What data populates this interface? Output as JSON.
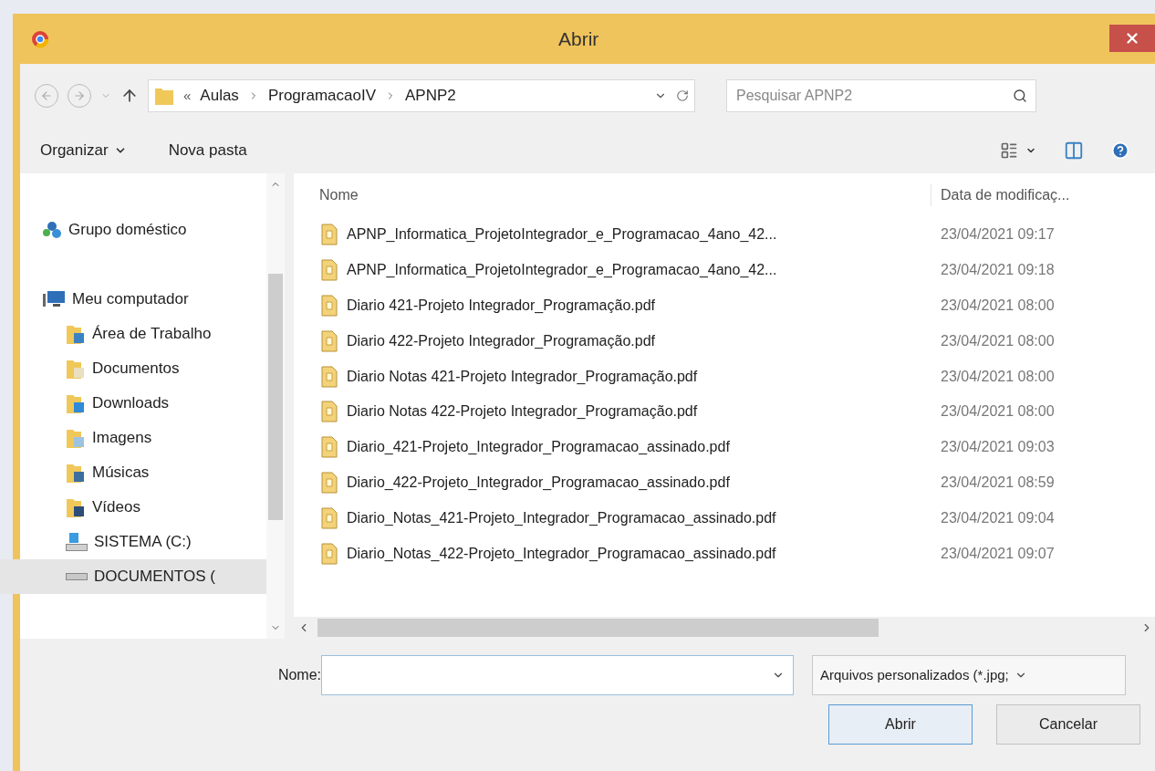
{
  "window": {
    "title": "Abrir"
  },
  "address": {
    "prefix": "«",
    "path": [
      "Aulas",
      "ProgramacaoIV",
      "APNP2"
    ]
  },
  "search": {
    "placeholder": "Pesquisar APNP2"
  },
  "toolbar": {
    "organize": "Organizar",
    "new_folder": "Nova pasta"
  },
  "sidebar": {
    "items": [
      {
        "label": "Grupo doméstico",
        "kind": "group",
        "selected": false
      },
      {
        "label": "Meu computador",
        "kind": "computer",
        "selected": false,
        "children": [
          {
            "label": "Área de Trabalho",
            "kind": "desktop",
            "selected": false
          },
          {
            "label": "Documentos",
            "kind": "documents",
            "selected": false
          },
          {
            "label": "Downloads",
            "kind": "downloads",
            "selected": false
          },
          {
            "label": "Imagens",
            "kind": "images",
            "selected": false
          },
          {
            "label": "Músicas",
            "kind": "music",
            "selected": false
          },
          {
            "label": "Vídeos",
            "kind": "videos",
            "selected": false
          },
          {
            "label": "SISTEMA (C:)",
            "kind": "system-drive",
            "selected": false
          },
          {
            "label": "DOCUMENTOS (",
            "kind": "drive",
            "selected": true
          }
        ]
      }
    ]
  },
  "table": {
    "columns": [
      "Nome",
      "Data de modificaç..."
    ],
    "rows": [
      {
        "name": "APNP_Informatica_ProjetoIntegrador_e_Programacao_4ano_42...",
        "date": "23/04/2021 09:17"
      },
      {
        "name": "APNP_Informatica_ProjetoIntegrador_e_Programacao_4ano_42...",
        "date": "23/04/2021 09:18"
      },
      {
        "name": "Diario 421-Projeto Integrador_Programação.pdf",
        "date": "23/04/2021 08:00"
      },
      {
        "name": "Diario 422-Projeto Integrador_Programação.pdf",
        "date": "23/04/2021 08:00"
      },
      {
        "name": "Diario Notas 421-Projeto Integrador_Programação.pdf",
        "date": "23/04/2021 08:00"
      },
      {
        "name": "Diario Notas 422-Projeto Integrador_Programação.pdf",
        "date": "23/04/2021 08:00"
      },
      {
        "name": "Diario_421-Projeto_Integrador_Programacao_assinado.pdf",
        "date": "23/04/2021 09:03"
      },
      {
        "name": "Diario_422-Projeto_Integrador_Programacao_assinado.pdf",
        "date": "23/04/2021 08:59"
      },
      {
        "name": "Diario_Notas_421-Projeto_Integrador_Programacao_assinado.pdf",
        "date": "23/04/2021 09:04"
      },
      {
        "name": "Diario_Notas_422-Projeto_Integrador_Programacao_assinado.pdf",
        "date": "23/04/2021 09:07"
      }
    ]
  },
  "footer": {
    "name_label": "Nome:",
    "file_type": "Arquivos personalizados (*.jpg;",
    "buttons": [
      {
        "label": "Abrir",
        "kind": "primary"
      },
      {
        "label": "Cancelar",
        "kind": "secondary"
      }
    ]
  }
}
